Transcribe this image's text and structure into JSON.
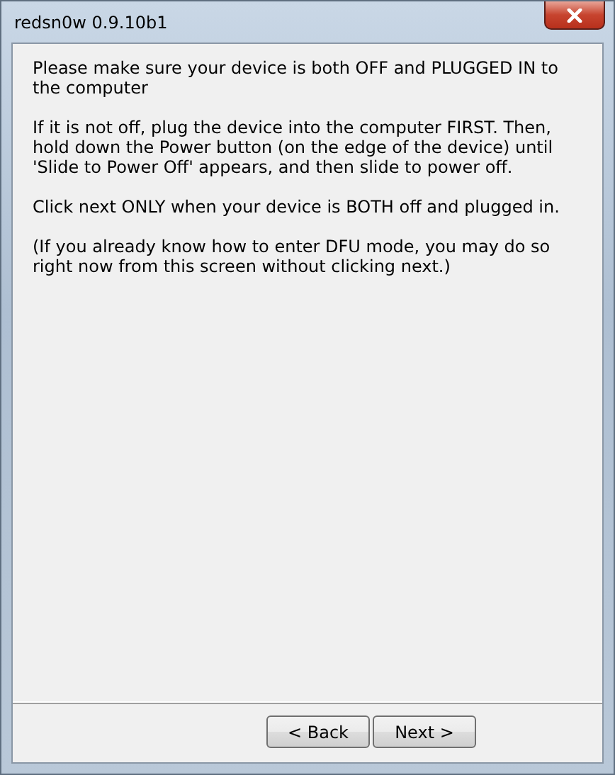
{
  "window": {
    "title": "redsn0w 0.9.10b1"
  },
  "paragraphs": [
    "Please make sure your device is both OFF and PLUGGED IN to the computer",
    "If it is not off, plug the device into the computer FIRST. Then, hold down the Power button (on the edge of the device) until 'Slide to Power Off' appears, and then slide to power off.",
    "Click next ONLY when your device is BOTH off and plugged in.",
    "(If you already know how to enter DFU mode, you may do so right now from this screen without clicking next.)"
  ],
  "buttons": [
    {
      "label": "< Back",
      "disabled": false
    },
    {
      "label": "Next >",
      "disabled": false
    }
  ]
}
